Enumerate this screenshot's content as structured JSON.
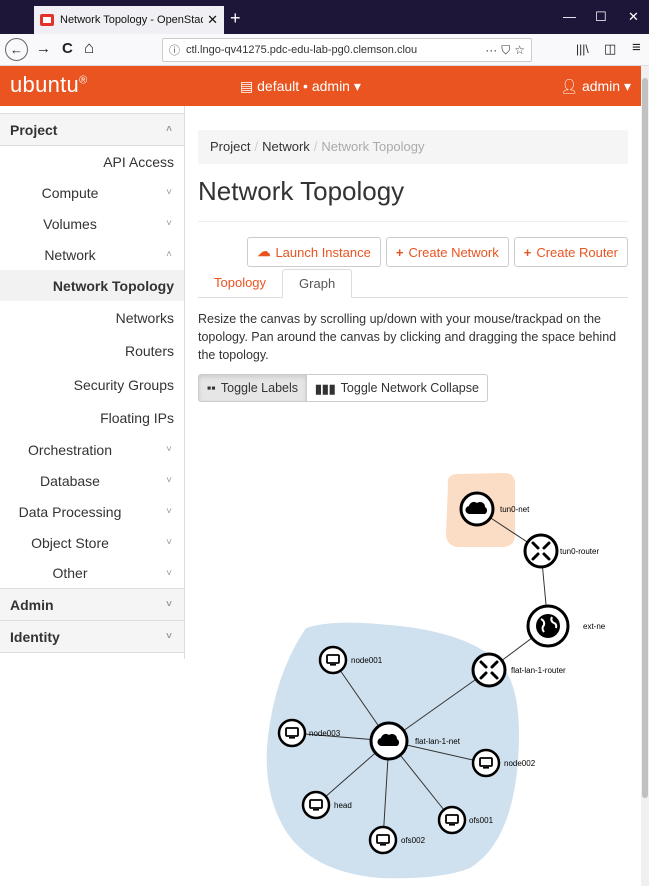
{
  "browser": {
    "tab_title": "Network Topology - OpenStac",
    "tab_close": "✕",
    "new_tab": "+",
    "win_min": "—",
    "win_max": "☐",
    "win_close": "✕",
    "url_host": "ctl.lngo-qv41275.pdc-edu-lab-pg0.clemson.clou",
    "url_more": "···",
    "nav_back": "←",
    "nav_forward": "→",
    "nav_reload": "C",
    "nav_home": "⌂",
    "library": "|||\\",
    "sidebar_toggle": "◫",
    "menu": "≡"
  },
  "header": {
    "logo": "ubuntu",
    "logo_mark": "®",
    "project_selector": "default • admin ▾",
    "user_menu": "admin ▾"
  },
  "sidebar": {
    "project": "Project",
    "api_access": "API Access",
    "compute": "Compute",
    "volumes": "Volumes",
    "network": "Network",
    "network_topology": "Network Topology",
    "networks": "Networks",
    "routers": "Routers",
    "security_groups": "Security Groups",
    "floating_ips": "Floating IPs",
    "orchestration": "Orchestration",
    "database": "Database",
    "data_processing": "Data Processing",
    "object_store": "Object Store",
    "other": "Other",
    "admin": "Admin",
    "identity": "Identity",
    "chev_down": "˅",
    "chev_up": "˄"
  },
  "breadcrumb": {
    "project": "Project",
    "network": "Network",
    "current": "Network Topology",
    "sep": "/"
  },
  "page": {
    "title": "Network Topology",
    "launch_instance": "Launch Instance",
    "create_network": "Create Network",
    "create_router": "Create Router",
    "plus": "+",
    "tab_topology": "Topology",
    "tab_graph": "Graph",
    "help_text": "Resize the canvas by scrolling up/down with your mouse/trackpad on the topology. Pan around the canvas by clicking and dragging the space behind the topology.",
    "toggle_labels": "Toggle Labels",
    "toggle_collapse": "Toggle Network Collapse",
    "labels_icon": "▪▪",
    "collapse_icon": "▮▮▮"
  },
  "graph": {
    "nodes": {
      "tun0_net": "tun0-net",
      "tun0_router": "tun0-router",
      "ext_net": "ext-ne",
      "flat_router": "flat-lan-1-router",
      "flat_net": "flat-lan-1-net",
      "node001": "node001",
      "node002": "node002",
      "node003": "node003",
      "head": "head",
      "ofs001": "ofs001",
      "ofs002": "ofs002"
    },
    "colors": {
      "tun0_zone": "#fbdcc4",
      "flat_zone": "#cfe0ee"
    }
  }
}
